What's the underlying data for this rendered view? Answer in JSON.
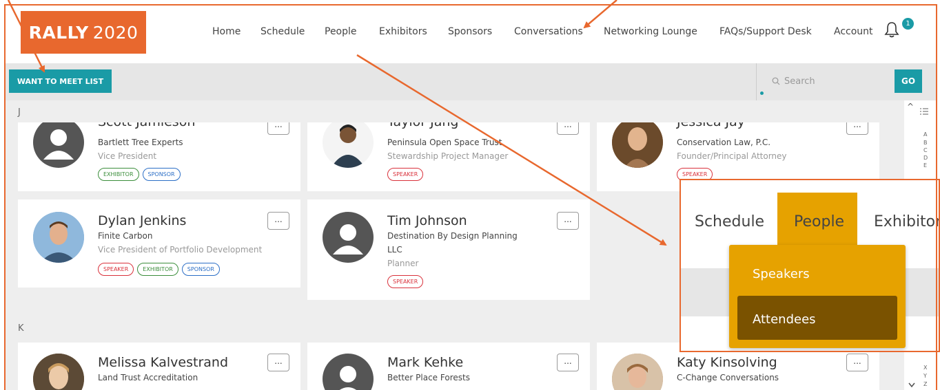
{
  "header": {
    "logo_bold": "RALLY",
    "logo_year": "2020",
    "nav": [
      "Home",
      "Schedule",
      "People",
      "Exhibitors",
      "Sponsors",
      "Conversations",
      "Networking Lounge",
      "FAQs/Support Desk",
      "Account"
    ],
    "notification_count": "1"
  },
  "toolbar": {
    "want_to_meet": "WANT TO MEET LIST",
    "search_placeholder": "Search",
    "go": "GO"
  },
  "sections": {
    "j": "J",
    "k": "K"
  },
  "cards": {
    "scott": {
      "name": "Scott Jamieson",
      "org": "Bartlett Tree Experts",
      "title": "Vice President",
      "tags": [
        "EXHIBITOR",
        "SPONSOR"
      ]
    },
    "taylor": {
      "name": "Taylor Jang",
      "org": "Peninsula Open Space Trust",
      "title": "Stewardship Project Manager",
      "tags": [
        "SPEAKER"
      ]
    },
    "jessica": {
      "name": "Jessica Jay",
      "org": "Conservation Law, P.C.",
      "title": "Founder/Principal Attorney",
      "tags": [
        "SPEAKER"
      ]
    },
    "dylan": {
      "name": "Dylan Jenkins",
      "org": "Finite Carbon",
      "title": "Vice President of Portfolio Development",
      "tags": [
        "SPEAKER",
        "EXHIBITOR",
        "SPONSOR"
      ]
    },
    "tim": {
      "name": "Tim Johnson",
      "org1": "Destination By Design Planning",
      "org2": "LLC",
      "title": "Planner",
      "tags": [
        "SPEAKER"
      ]
    },
    "melissa": {
      "name": "Melissa Kalvestrand",
      "org": "Land Trust Accreditation"
    },
    "mark": {
      "name": "Mark Kehke",
      "org": "Better Place Forests"
    },
    "katy": {
      "name": "Katy Kinsolving",
      "org": "C-Change Conversations"
    }
  },
  "more_label": "...",
  "alphabet_top": [
    "A",
    "B",
    "C",
    "D",
    "E"
  ],
  "alphabet_bottom": [
    "X",
    "Y",
    "Z"
  ],
  "zoom": {
    "schedule": "Schedule",
    "people": "People",
    "exhibitors": "Exhibitors",
    "speakers": "Speakers",
    "attendees": "Attendees"
  },
  "colors": {
    "brand_orange": "#e8682e",
    "teal": "#1a9ba6",
    "menu_gold": "#e6a200",
    "menu_dark": "#7a5200"
  }
}
